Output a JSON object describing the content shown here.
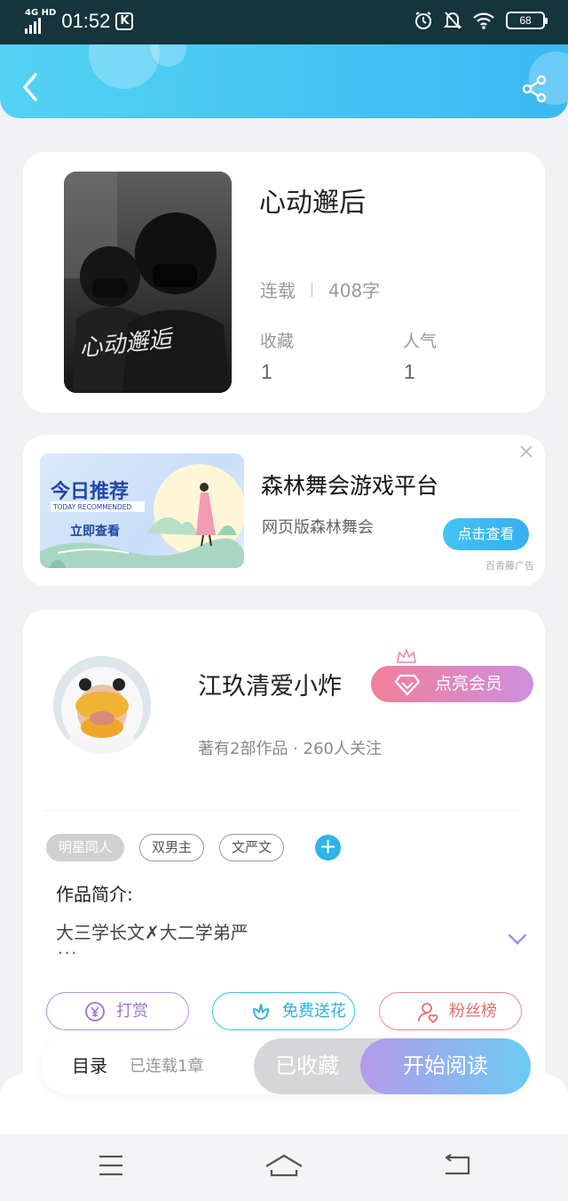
{
  "status_bar": {
    "network": "4G HD",
    "time": "01:52",
    "app_badge": "K",
    "battery": "68"
  },
  "header": {
    "back_icon": "chevron-left-icon",
    "share_icon": "share-icon"
  },
  "book": {
    "title": "心动邂后",
    "cover_text": "心动邂逅",
    "status": "连载",
    "word_count": "408字",
    "stats": [
      {
        "label": "收藏",
        "value": "1"
      },
      {
        "label": "人气",
        "value": "1"
      }
    ]
  },
  "ad": {
    "banner_title": "今日推荐",
    "banner_sub": "TODAY RECOMMENDED",
    "banner_cta": "立即查看",
    "title": "森林舞会游戏平台",
    "subtitle": "网页版森林舞会",
    "button": "点击查看",
    "source": "百青藤广告"
  },
  "author": {
    "name": "江玖清爱小炸",
    "meta": "著有2部作品 · 260人关注",
    "vip_button": "点亮会员"
  },
  "tags": [
    "明星同人",
    "双男主",
    "文严文"
  ],
  "intro": {
    "label": "作品简介:",
    "text": "大三学长文✗大二学弟严",
    "ellipsis": "..."
  },
  "actions": {
    "reward": "打赏",
    "flower": "免费送花",
    "fans": "粉丝榜"
  },
  "read_bar": {
    "toc": "目录",
    "chapters": "已连载1章",
    "collected": "已收藏",
    "start": "开始阅读"
  },
  "colors": {
    "accent": "#3ab9f2",
    "vip_start": "#f17f98",
    "vip_end": "#ce8fe0"
  }
}
